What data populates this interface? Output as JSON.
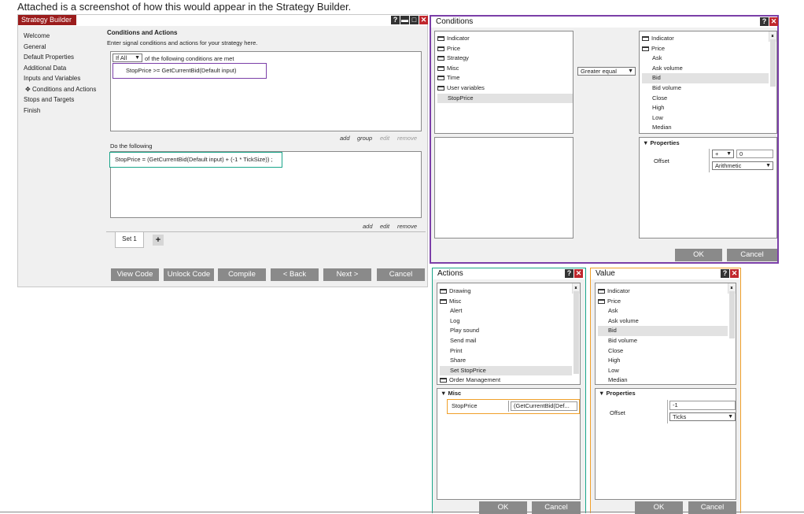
{
  "caption": "Attached is a screenshot of how this would appear in the Strategy Builder.",
  "strategy_builder": {
    "title": "Strategy Builder",
    "nav": [
      "Welcome",
      "General",
      "Default Properties",
      "Additional Data",
      "Inputs and Variables",
      "Conditions and Actions",
      "Stops and Targets",
      "Finish"
    ],
    "active_nav_marker": "✥",
    "heading": "Conditions and Actions",
    "subheading": "Enter signal conditions and actions for your strategy here.",
    "if_select": "If All",
    "conditions_suffix": "of the following conditions are met",
    "condition_row": "StopPrice >= GetCurrentBid(Default input)",
    "cond_links": {
      "add": "add",
      "group": "group",
      "edit": "edit",
      "remove": "remove"
    },
    "do_label": "Do the following",
    "action_row": "StopPrice = (GetCurrentBid(Default input) + (-1 * TickSize)) ;",
    "act_links": {
      "add": "add",
      "edit": "edit",
      "remove": "remove"
    },
    "set_tab": "Set 1",
    "add_set": "+",
    "buttons": {
      "view_code": "View Code",
      "unlock_code": "Unlock Code",
      "compile": "Compile",
      "back": "< Back",
      "next": "Next >",
      "cancel": "Cancel"
    }
  },
  "conditions_window": {
    "title": "Conditions",
    "left_tree": [
      "Indicator",
      "Price",
      "Strategy",
      "Misc",
      "Time",
      "User variables",
      "StopPrice"
    ],
    "operator": "Greater equal",
    "right_tree": [
      "Indicator",
      "Price",
      "Ask",
      "Ask volume",
      "Bid",
      "Bid volume",
      "Close",
      "High",
      "Low",
      "Median"
    ],
    "properties_label": "Properties",
    "offset_label": "Offset",
    "offset_sign": "+",
    "offset_value": "0",
    "offset_type": "Arithmetic",
    "ok": "OK",
    "cancel": "Cancel"
  },
  "actions_window": {
    "title": "Actions",
    "tree": [
      "Drawing",
      "Misc",
      "Alert",
      "Log",
      "Play sound",
      "Send mail",
      "Print",
      "Share",
      "Set StopPrice",
      "Order Management"
    ],
    "misc_label": "Misc",
    "stopprice_label": "StopPrice",
    "stopprice_value": "(GetCurrentBid(Def...",
    "ok": "OK",
    "cancel": "Cancel"
  },
  "value_window": {
    "title": "Value",
    "tree": [
      "Indicator",
      "Price",
      "Ask",
      "Ask volume",
      "Bid",
      "Bid volume",
      "Close",
      "High",
      "Low",
      "Median"
    ],
    "properties_label": "Properties",
    "offset_label": "Offset",
    "offset_value": "-1",
    "offset_type": "Ticks",
    "ok": "OK",
    "cancel": "Cancel"
  },
  "colors": {
    "title_red": "#9b1c1c",
    "highlight_purple": "#7b3fa8",
    "highlight_teal": "#1aa58a",
    "highlight_orange": "#f0a02a",
    "button_grey": "#8a8a8a"
  }
}
